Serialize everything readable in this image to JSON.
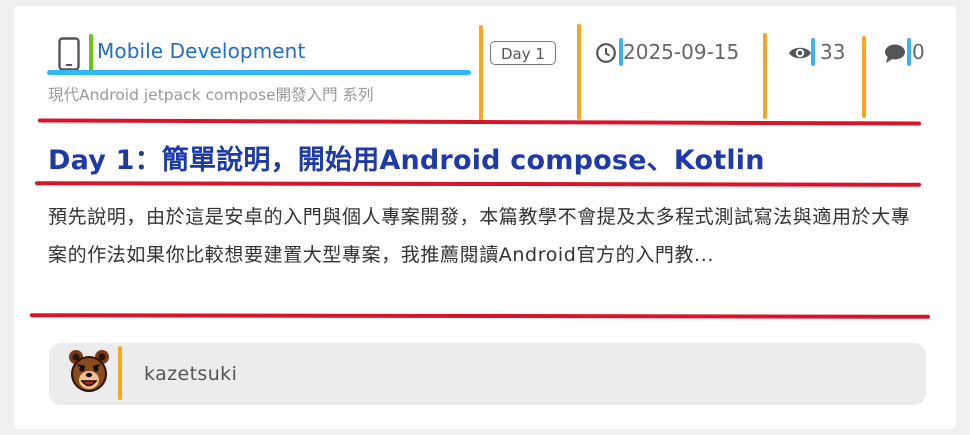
{
  "post": {
    "category": "Mobile Development",
    "series": "現代Android jetpack compose開發入門 系列",
    "day_badge": "Day 1",
    "date": "2025-09-15",
    "views": "33",
    "comments": "0",
    "title": "Day 1：簡單說明，開始用Android compose、Kotlin",
    "excerpt": "預先說明，由於這是安卓的入門與個人專案開發，本篇教學不會提及太多程式測試寫法與適用於大專案的作法如果你比較想要建置大型專案，我推薦閱讀Android官方的入門教..."
  },
  "author": {
    "name": "kazetsuki"
  },
  "icons": {
    "category": "mobile-phone-icon",
    "date": "clock-icon",
    "views": "eye-icon",
    "comments": "speech-bubble-icon",
    "avatar": "bear-avatar"
  },
  "colors": {
    "category_link": "#1f6fc4",
    "title": "#1d3aa6",
    "annotation_red": "#d9132a",
    "annotation_blue": "#2fb8f3",
    "annotation_orange": "#f5a623",
    "annotation_green": "#6cc417"
  }
}
